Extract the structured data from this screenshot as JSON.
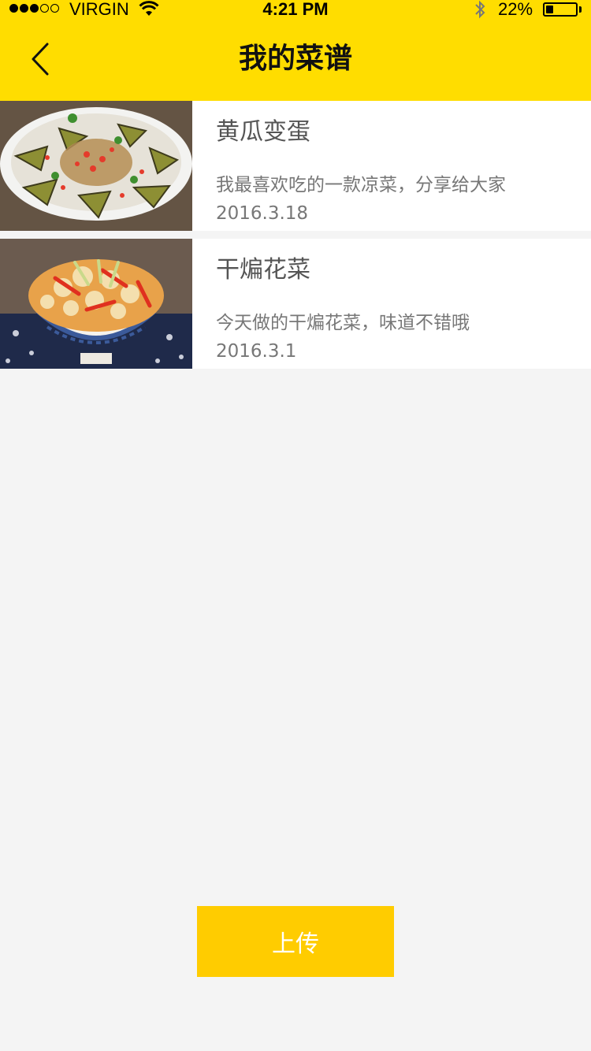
{
  "status_bar": {
    "carrier": "VIRGIN",
    "time": "4:21 PM",
    "battery": "22%",
    "battery_level": 0.22,
    "signal_bars_filled": 3,
    "signal_bars_total": 5,
    "icons": [
      "signal-dots",
      "wifi-icon",
      "bluetooth-icon",
      "battery-icon"
    ]
  },
  "nav": {
    "title": "我的菜谱",
    "back_icon": "chevron-left-icon"
  },
  "recipes": [
    {
      "title": "黄瓜变蛋",
      "description": "我最喜欢吃的一款凉菜，分享给大家",
      "date": "2016.3.18"
    },
    {
      "title": "干煸花菜",
      "description": "今天做的干煸花菜，味道不错哦",
      "date": "2016.3.1"
    }
  ],
  "actions": {
    "upload_label": "上传"
  },
  "colors": {
    "header_bg": "#ffdd00",
    "button_bg": "#ffcc00",
    "page_bg": "#f4f4f4"
  }
}
